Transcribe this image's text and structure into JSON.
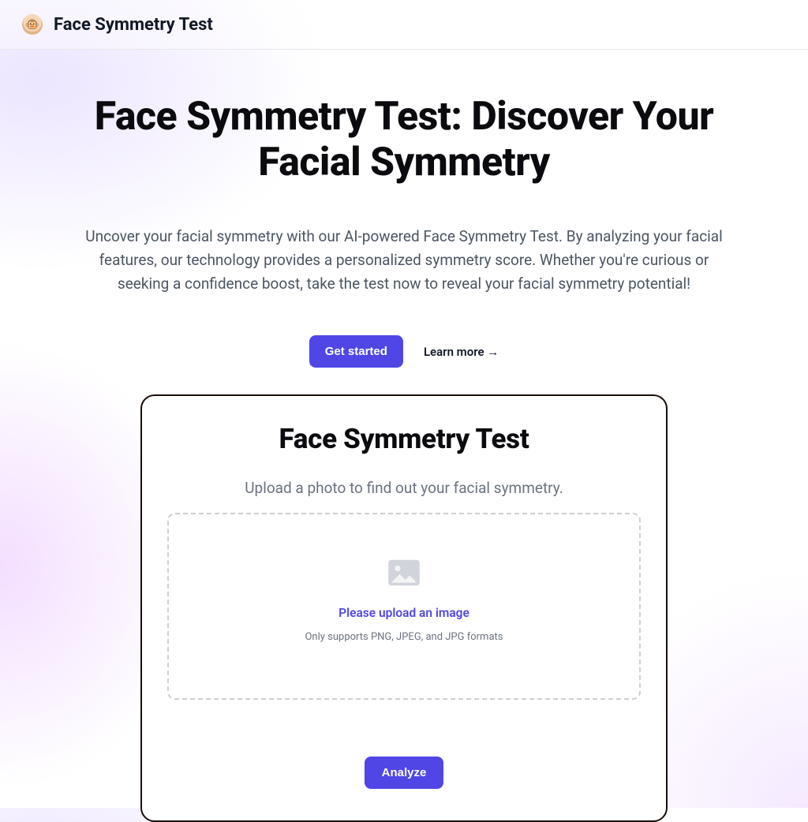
{
  "header": {
    "brand": "Face Symmetry Test"
  },
  "hero": {
    "title": "Face Symmetry Test: Discover Your Facial Symmetry",
    "subtitle": "Uncover your facial symmetry with our AI-powered Face Symmetry Test. By analyzing your facial features, our technology provides a personalized symmetry score. Whether you're curious or seeking a confidence boost, take the test now to reveal your facial symmetry potential!",
    "cta_primary": "Get started",
    "cta_secondary": "Learn more →"
  },
  "card": {
    "title": "Face Symmetry Test",
    "subtitle": "Upload a photo to find out your facial symmetry.",
    "upload_prompt": "Please upload an image",
    "upload_hint": "Only supports PNG, JPEG, and JPG formats",
    "analyze_label": "Analyze"
  }
}
